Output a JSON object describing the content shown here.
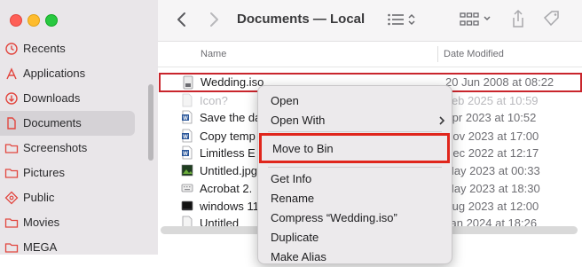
{
  "window": {
    "title": "Documents — Local"
  },
  "sidebar": {
    "items": [
      {
        "label": "Recents",
        "icon": "clock-icon"
      },
      {
        "label": "Applications",
        "icon": "applications-icon"
      },
      {
        "label": "Downloads",
        "icon": "download-icon"
      },
      {
        "label": "Documents",
        "icon": "document-icon",
        "active": true
      },
      {
        "label": "Screenshots",
        "icon": "folder-icon"
      },
      {
        "label": "Pictures",
        "icon": "folder-icon"
      },
      {
        "label": "Public",
        "icon": "public-icon"
      },
      {
        "label": "Movies",
        "icon": "folder-icon"
      },
      {
        "label": "MEGA",
        "icon": "folder-icon"
      }
    ]
  },
  "columns": {
    "name": "Name",
    "date": "Date Modified"
  },
  "files": [
    {
      "name": "Wedding.iso",
      "date": "20 Jun 2008 at 08:22",
      "icon": "disk-image-icon",
      "selected": true
    },
    {
      "name": "Icon?",
      "date": "Feb 2025 at 10:59",
      "icon": "blank-file-icon",
      "faded": true
    },
    {
      "name": "Save the da",
      "date": "Apr 2023 at 10:52",
      "icon": "word-document-icon"
    },
    {
      "name": "Copy temp",
      "date": "Nov 2023 at 17:00",
      "icon": "word-document-icon"
    },
    {
      "name": "Limitless E",
      "date": "Dec 2022 at 12:17",
      "icon": "word-document-icon"
    },
    {
      "name": "Untitled.jpg",
      "date": "May 2023 at 00:33",
      "icon": "image-file-icon"
    },
    {
      "name": "Acrobat 2.",
      "date": "May 2023 at 18:30",
      "icon": "keyboard-file-icon"
    },
    {
      "name": "windows 11",
      "date": "Aug 2023 at 12:00",
      "icon": "terminal-file-icon"
    },
    {
      "name": "Untitled",
      "date": "Jan 2024 at 18:26",
      "icon": "blank-file-icon"
    }
  ],
  "context_menu": {
    "items": [
      {
        "label": "Open"
      },
      {
        "label": "Open With",
        "submenu": true
      },
      {
        "label": "Move to Bin",
        "highlighted": true
      },
      {
        "label": "Get Info"
      },
      {
        "label": "Rename"
      },
      {
        "label": "Compress “Wedding.iso”"
      },
      {
        "label": "Duplicate"
      },
      {
        "label": "Make Alias"
      }
    ]
  },
  "colors": {
    "accent_highlight": "#e0261c",
    "selection_outline": "#c9252c",
    "sidebar_icon": "#e2463f"
  }
}
